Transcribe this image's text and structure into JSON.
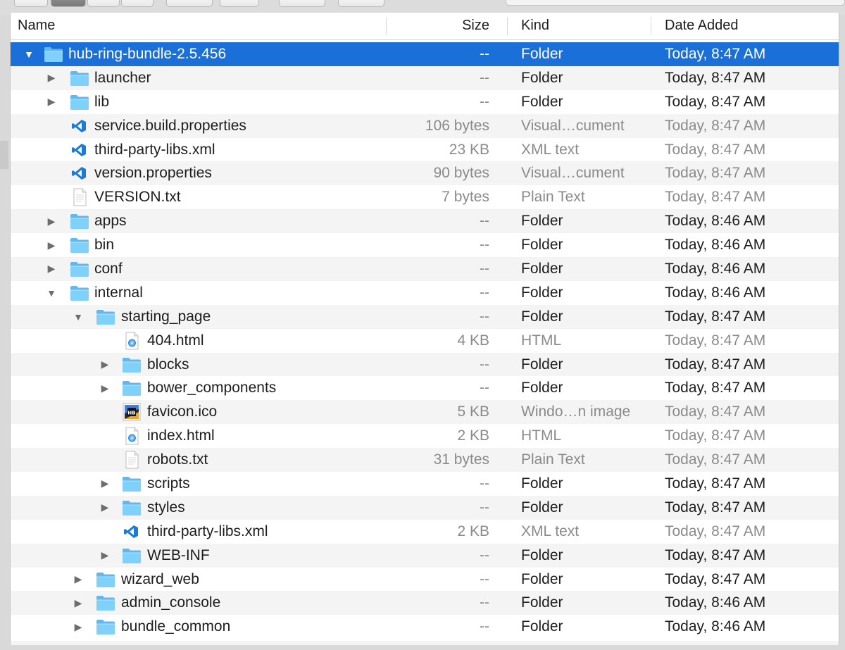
{
  "columns": {
    "name": "Name",
    "size": "Size",
    "kind": "Kind",
    "date": "Date Added"
  },
  "colors": {
    "selection": "#1a6fd8",
    "folder": "#6cc5f7",
    "meta_text": "#8a8a8a"
  },
  "rows": [
    {
      "name": "hub-ring-bundle-2.5.456",
      "size": "--",
      "kind": "Folder",
      "date": "Today, 8:47 AM",
      "level": 0,
      "icon": "folder-icon",
      "disclosure": "expanded",
      "selected": true
    },
    {
      "name": "launcher",
      "size": "--",
      "kind": "Folder",
      "date": "Today, 8:47 AM",
      "level": 1,
      "icon": "folder-icon",
      "disclosure": "collapsed"
    },
    {
      "name": "lib",
      "size": "--",
      "kind": "Folder",
      "date": "Today, 8:47 AM",
      "level": 1,
      "icon": "folder-icon",
      "disclosure": "collapsed"
    },
    {
      "name": "service.build.properties",
      "size": "106 bytes",
      "kind": "Visual…cument",
      "date": "Today, 8:47 AM",
      "level": 1,
      "icon": "vscode-file-icon",
      "disclosure": "none"
    },
    {
      "name": "third-party-libs.xml",
      "size": "23 KB",
      "kind": "XML text",
      "date": "Today, 8:47 AM",
      "level": 1,
      "icon": "vscode-file-icon",
      "disclosure": "none"
    },
    {
      "name": "version.properties",
      "size": "90 bytes",
      "kind": "Visual…cument",
      "date": "Today, 8:47 AM",
      "level": 1,
      "icon": "vscode-file-icon",
      "disclosure": "none"
    },
    {
      "name": "VERSION.txt",
      "size": "7 bytes",
      "kind": "Plain Text",
      "date": "Today, 8:47 AM",
      "level": 1,
      "icon": "text-file-icon",
      "disclosure": "none"
    },
    {
      "name": "apps",
      "size": "--",
      "kind": "Folder",
      "date": "Today, 8:46 AM",
      "level": 1,
      "icon": "folder-icon",
      "disclosure": "collapsed"
    },
    {
      "name": "bin",
      "size": "--",
      "kind": "Folder",
      "date": "Today, 8:46 AM",
      "level": 1,
      "icon": "folder-icon",
      "disclosure": "collapsed"
    },
    {
      "name": "conf",
      "size": "--",
      "kind": "Folder",
      "date": "Today, 8:46 AM",
      "level": 1,
      "icon": "folder-icon",
      "disclosure": "collapsed"
    },
    {
      "name": "internal",
      "size": "--",
      "kind": "Folder",
      "date": "Today, 8:46 AM",
      "level": 1,
      "icon": "folder-icon",
      "disclosure": "expanded"
    },
    {
      "name": "starting_page",
      "size": "--",
      "kind": "Folder",
      "date": "Today, 8:47 AM",
      "level": 2,
      "icon": "folder-icon",
      "disclosure": "expanded"
    },
    {
      "name": "404.html",
      "size": "4 KB",
      "kind": "HTML",
      "date": "Today, 8:47 AM",
      "level": 3,
      "icon": "html-file-icon",
      "disclosure": "none"
    },
    {
      "name": "blocks",
      "size": "--",
      "kind": "Folder",
      "date": "Today, 8:47 AM",
      "level": 3,
      "icon": "folder-icon",
      "disclosure": "collapsed"
    },
    {
      "name": "bower_components",
      "size": "--",
      "kind": "Folder",
      "date": "Today, 8:47 AM",
      "level": 3,
      "icon": "folder-icon",
      "disclosure": "collapsed"
    },
    {
      "name": "favicon.ico",
      "size": "5 KB",
      "kind": "Windo…n image",
      "date": "Today, 8:47 AM",
      "level": 3,
      "icon": "ico-file-icon",
      "disclosure": "none"
    },
    {
      "name": "index.html",
      "size": "2 KB",
      "kind": "HTML",
      "date": "Today, 8:47 AM",
      "level": 3,
      "icon": "html-file-icon",
      "disclosure": "none"
    },
    {
      "name": "robots.txt",
      "size": "31 bytes",
      "kind": "Plain Text",
      "date": "Today, 8:47 AM",
      "level": 3,
      "icon": "text-file-icon",
      "disclosure": "none"
    },
    {
      "name": "scripts",
      "size": "--",
      "kind": "Folder",
      "date": "Today, 8:47 AM",
      "level": 3,
      "icon": "folder-icon",
      "disclosure": "collapsed"
    },
    {
      "name": "styles",
      "size": "--",
      "kind": "Folder",
      "date": "Today, 8:47 AM",
      "level": 3,
      "icon": "folder-icon",
      "disclosure": "collapsed"
    },
    {
      "name": "third-party-libs.xml",
      "size": "2 KB",
      "kind": "XML text",
      "date": "Today, 8:47 AM",
      "level": 3,
      "icon": "vscode-file-icon",
      "disclosure": "none"
    },
    {
      "name": "WEB-INF",
      "size": "--",
      "kind": "Folder",
      "date": "Today, 8:47 AM",
      "level": 3,
      "icon": "folder-icon",
      "disclosure": "collapsed"
    },
    {
      "name": "wizard_web",
      "size": "--",
      "kind": "Folder",
      "date": "Today, 8:47 AM",
      "level": 2,
      "icon": "folder-icon",
      "disclosure": "collapsed"
    },
    {
      "name": "admin_console",
      "size": "--",
      "kind": "Folder",
      "date": "Today, 8:46 AM",
      "level": 2,
      "icon": "folder-icon",
      "disclosure": "collapsed"
    },
    {
      "name": "bundle_common",
      "size": "--",
      "kind": "Folder",
      "date": "Today, 8:46 AM",
      "level": 2,
      "icon": "folder-icon",
      "disclosure": "collapsed"
    }
  ]
}
